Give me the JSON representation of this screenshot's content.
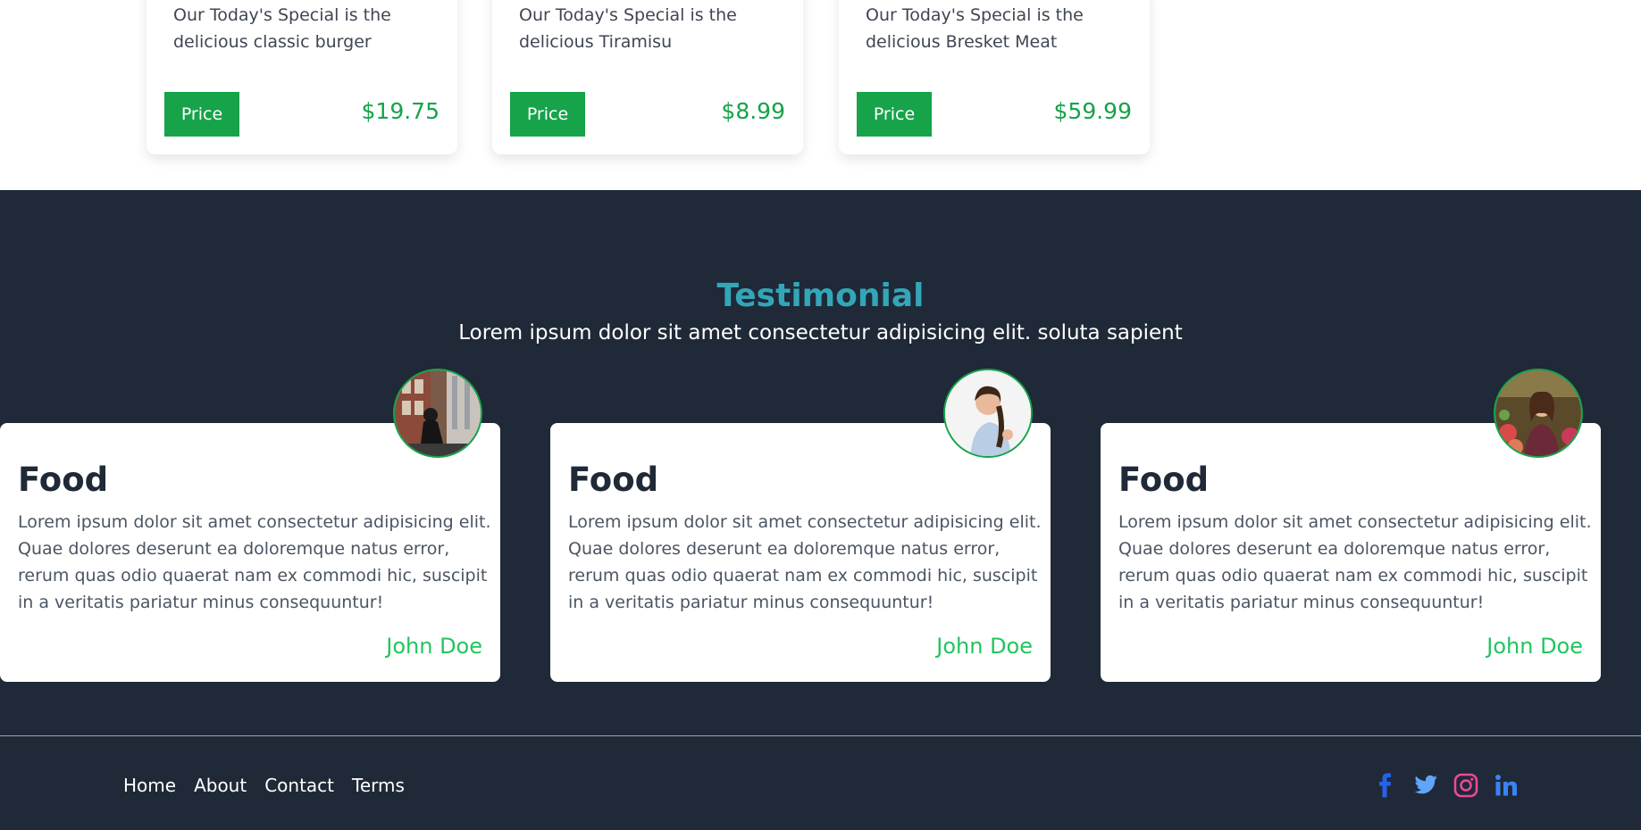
{
  "menu": {
    "cards": [
      {
        "description": "Our Today's Special is the delicious classic burger",
        "button_label": "Price",
        "price": "$19.75"
      },
      {
        "description": "Our Today's Special is the delicious Tiramisu",
        "button_label": "Price",
        "price": "$8.99"
      },
      {
        "description": "Our Today's Special is the delicious Bresket Meat",
        "button_label": "Price",
        "price": "$59.99"
      }
    ]
  },
  "testimonial": {
    "title": "Testimonial",
    "subtitle": "Lorem ipsum dolor sit amet consectetur adipisicing elit. soluta sapient",
    "cards": [
      {
        "heading": "Food",
        "text": "Lorem ipsum dolor sit amet consectetur adipisicing elit. Quae dolores deserunt ea doloremque natus error, rerum quas odio quaerat nam ex commodi hic, suscipit in a veritatis pariatur minus consequuntur!",
        "author": "John Doe"
      },
      {
        "heading": "Food",
        "text": "Lorem ipsum dolor sit amet consectetur adipisicing elit. Quae dolores deserunt ea doloremque natus error, rerum quas odio quaerat nam ex commodi hic, suscipit in a veritatis pariatur minus consequuntur!",
        "author": "John Doe"
      },
      {
        "heading": "Food",
        "text": "Lorem ipsum dolor sit amet consectetur adipisicing elit. Quae dolores deserunt ea doloremque natus error, rerum quas odio quaerat nam ex commodi hic, suscipit in a veritatis pariatur minus consequuntur!",
        "author": "John Doe"
      }
    ]
  },
  "footer": {
    "links": [
      "Home",
      "About",
      "Contact",
      "Terms"
    ],
    "social_icons": [
      "facebook-icon",
      "twitter-icon",
      "instagram-icon",
      "linkedin-icon"
    ]
  },
  "colors": {
    "accent_green": "#16a34a",
    "author_green": "#22c55e",
    "title_teal": "#33a6b8",
    "dark_bg": "#1f2937"
  }
}
